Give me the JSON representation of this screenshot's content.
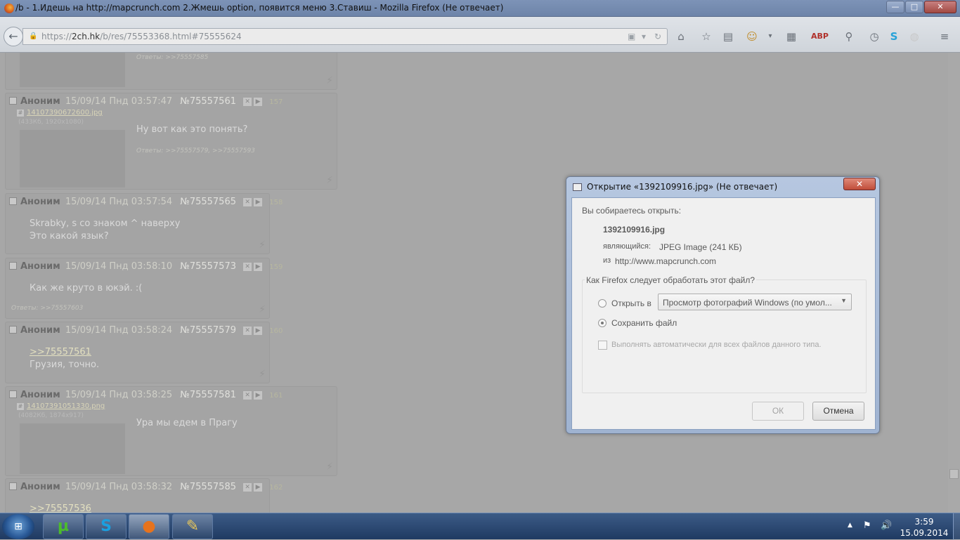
{
  "window": {
    "title": "/b - 1.Идешь на http://mapcrunch.com 2.Жмешь option, появится меню 3.Ставиш - Mozilla Firefox (Не отвечает)",
    "min_label": "—",
    "max_label": "□",
    "close_label": "✕"
  },
  "browser": {
    "url_prefix": "https://",
    "url_host": "2ch.hk",
    "url_path": "/b/res/75553368.html#75555624"
  },
  "posts": [
    {
      "replies": "Ответы: >>75557585"
    },
    {
      "name": "Аноним",
      "date": "15/09/14 Пнд 03:57:47",
      "num": "№75557561",
      "count": "157",
      "file": "14107390672600.jpg",
      "file_info": "(433Кб, 1920x1080)",
      "lines": [
        "Ну вот как это понять?"
      ],
      "replies": "Ответы: >>75557579, >>75557593"
    },
    {
      "name": "Аноним",
      "date": "15/09/14 Пнд 03:57:54",
      "num": "№75557565",
      "count": "158",
      "lines": [
        "Skrabky, s со знаком ^ наверху",
        "Это какой язык?"
      ]
    },
    {
      "name": "Аноним",
      "date": "15/09/14 Пнд 03:58:10",
      "num": "№75557573",
      "count": "159",
      "lines": [
        "Как же круто в юкэй. :("
      ],
      "replies": "Ответы: >>75557603"
    },
    {
      "name": "Аноним",
      "date": "15/09/14 Пнд 03:58:24",
      "num": "№75557579",
      "count": "160",
      "link": ">>75557561",
      "lines": [
        "Грузия, точно."
      ]
    },
    {
      "name": "Аноним",
      "date": "15/09/14 Пнд 03:58:25",
      "num": "№75557581",
      "count": "161",
      "file": "14107391051330.png",
      "file_info": "(4082Кб, 1874x917)",
      "lines": [
        "Ура мы едем в Прагу"
      ]
    },
    {
      "name": "Аноним",
      "date": "15/09/14 Пнд 03:58:32",
      "num": "№75557585",
      "count": "162",
      "link": ">>75557536"
    }
  ],
  "dialog": {
    "title": "Открытие «1392109916.jpg» (Не отвечает)",
    "intro": "Вы собираетесь открыть:",
    "filename": "1392109916.jpg",
    "type_label": "являющийся:",
    "type_value": "JPEG Image (241 КБ)",
    "from_label": "из",
    "from_value": "http://www.mapcrunch.com",
    "question": "Как Firefox следует обработать этот файл?",
    "open_with_label": "Открыть в",
    "open_with_value": "Просмотр фотографий Windows (по умол...",
    "save_label": "Сохранить файл",
    "auto_label": "Выполнять автоматически для всех файлов данного типа.",
    "ok_label": "ОК",
    "cancel_label": "Отмена",
    "close_label": "✕"
  },
  "taskbar": {
    "time": "3:59",
    "date": "15.09.2014"
  }
}
